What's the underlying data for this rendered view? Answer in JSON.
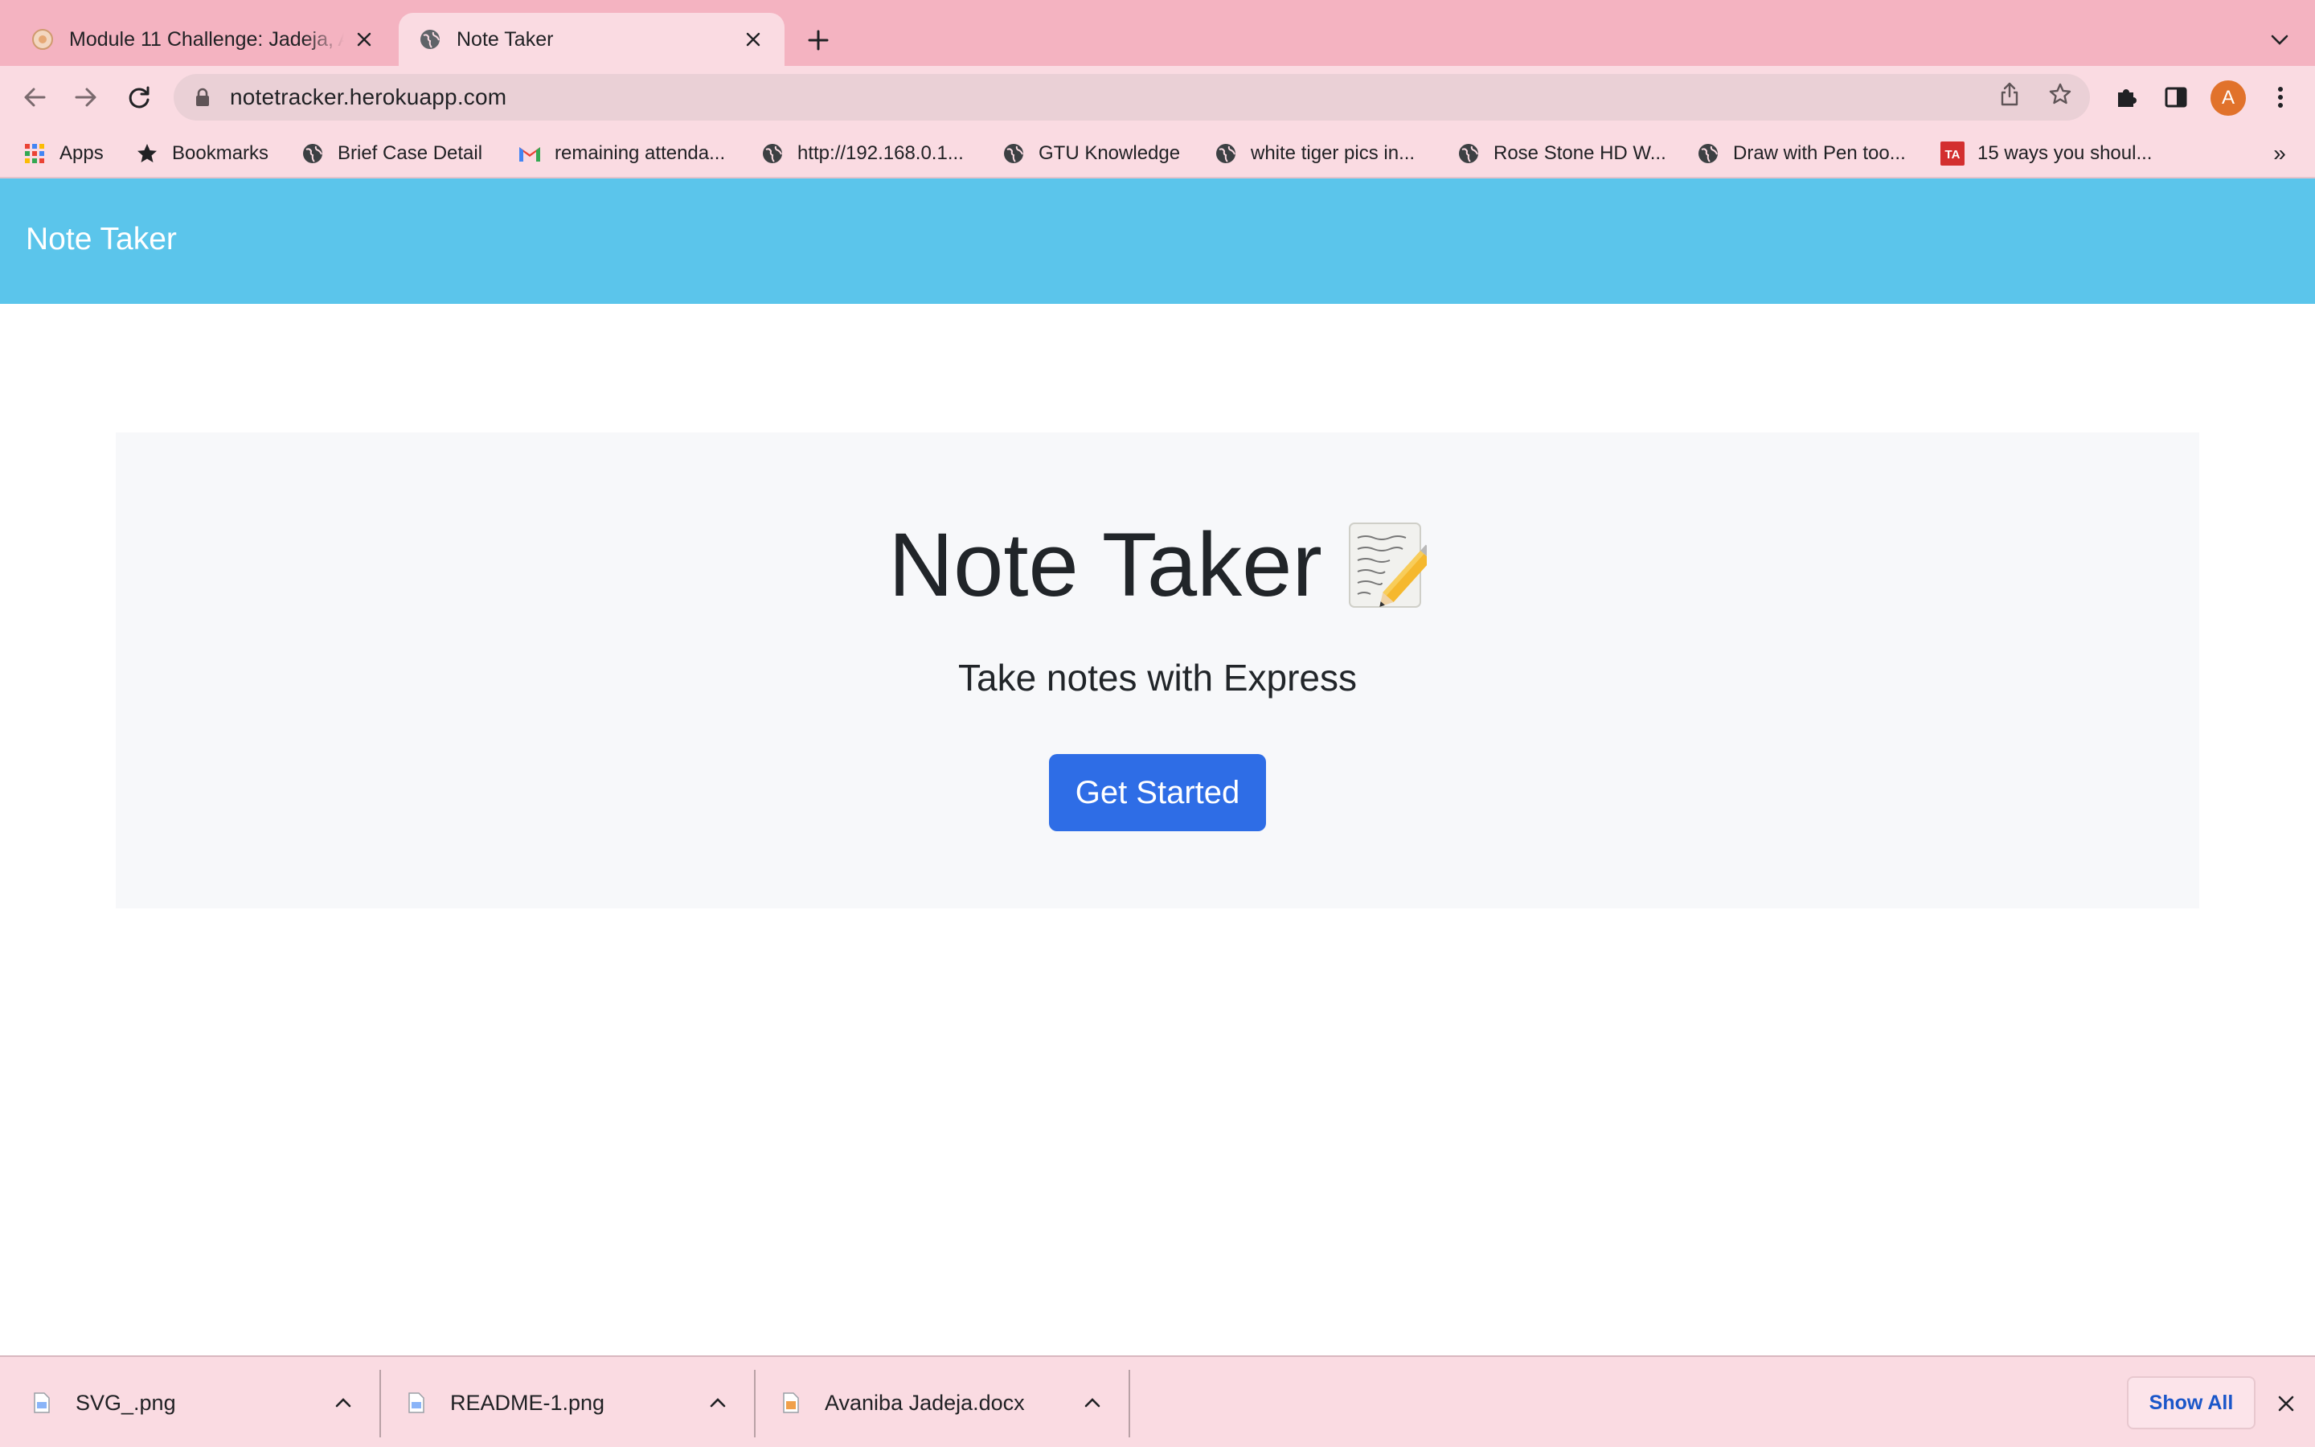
{
  "browser": {
    "tabs": [
      {
        "title": "Module 11 Challenge: Jadeja, A",
        "active": false,
        "icon": "module-favicon"
      },
      {
        "title": "Note Taker",
        "active": true,
        "icon": "globe-icon"
      }
    ],
    "url": "notetracker.herokuapp.com",
    "profile_initial": "A",
    "profile_color": "#e1722b"
  },
  "bookmarks": [
    {
      "label": "Apps",
      "icon": "apps-grid-icon"
    },
    {
      "label": "Bookmarks",
      "icon": "star-icon"
    },
    {
      "label": "Brief Case Detail",
      "icon": "globe-icon"
    },
    {
      "label": "remaining attenda...",
      "icon": "gmail-icon"
    },
    {
      "label": "http://192.168.0.1...",
      "icon": "globe-icon"
    },
    {
      "label": "GTU Knowledge",
      "icon": "globe-icon"
    },
    {
      "label": "white tiger pics in...",
      "icon": "globe-icon"
    },
    {
      "label": "Rose Stone HD W...",
      "icon": "globe-icon"
    },
    {
      "label": "Draw with Pen too...",
      "icon": "globe-icon"
    },
    {
      "label": "15 ways you shoul...",
      "icon": "ta-icon"
    }
  ],
  "bookmarks_overflow": "»",
  "page": {
    "navbar_brand": "Note Taker",
    "title": "Note Taker",
    "title_emoji": "memo-icon",
    "subtitle": "Take notes with Express",
    "cta_label": "Get Started",
    "navbar_color": "#5bc5eb",
    "cta_color": "#2e6de6"
  },
  "downloads": [
    {
      "filename": "SVG_.png",
      "icon": "image-file-icon"
    },
    {
      "filename": "README-1.png",
      "icon": "image-file-icon"
    },
    {
      "filename": "Avaniba Jadeja.docx",
      "icon": "docx-file-icon"
    }
  ],
  "downloads_show_all": "Show All"
}
